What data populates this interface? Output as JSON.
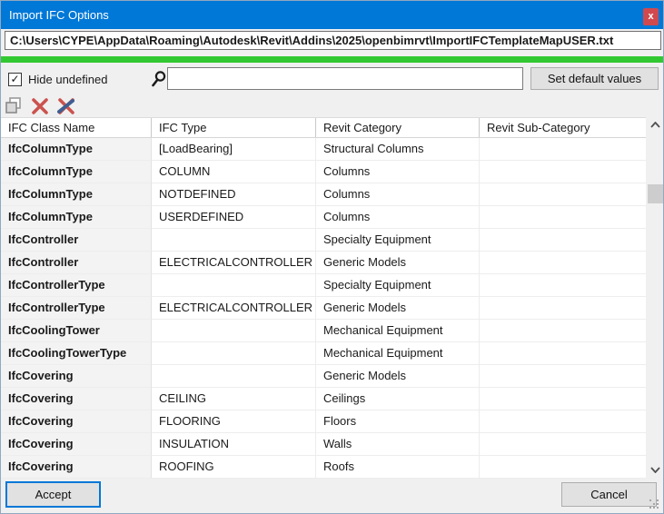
{
  "window": {
    "title": "Import IFC Options",
    "close_glyph": "x"
  },
  "path_bar": {
    "value": "C:\\Users\\CYPE\\AppData\\Roaming\\Autodesk\\Revit\\Addins\\2025\\openbimrvt\\ImportIFCTemplateMapUSER.txt"
  },
  "controls": {
    "hide_undefined_label": "Hide undefined",
    "hide_undefined_checked": true,
    "check_glyph": "✓",
    "search_value": "",
    "set_default_button_label": "Set default values"
  },
  "toolbar": {
    "icons": [
      "copy-icon",
      "delete-icon",
      "delete-all-icon"
    ]
  },
  "table": {
    "columns": [
      "IFC Class Name",
      "IFC Type",
      "Revit Category",
      "Revit Sub-Category"
    ],
    "rows": [
      [
        "IfcColumnType",
        "[LoadBearing]",
        "Structural Columns",
        ""
      ],
      [
        "IfcColumnType",
        "COLUMN",
        "Columns",
        ""
      ],
      [
        "IfcColumnType",
        "NOTDEFINED",
        "Columns",
        ""
      ],
      [
        "IfcColumnType",
        "USERDEFINED",
        "Columns",
        ""
      ],
      [
        "IfcController",
        "",
        "Specialty Equipment",
        ""
      ],
      [
        "IfcController",
        "ELECTRICALCONTROLLER",
        "Generic Models",
        ""
      ],
      [
        "IfcControllerType",
        "",
        "Specialty Equipment",
        ""
      ],
      [
        "IfcControllerType",
        "ELECTRICALCONTROLLER",
        "Generic Models",
        ""
      ],
      [
        "IfcCoolingTower",
        "",
        "Mechanical Equipment",
        ""
      ],
      [
        "IfcCoolingTowerType",
        "",
        "Mechanical Equipment",
        ""
      ],
      [
        "IfcCovering",
        "",
        "Generic Models",
        ""
      ],
      [
        "IfcCovering",
        "CEILING",
        "Ceilings",
        ""
      ],
      [
        "IfcCovering",
        "FLOORING",
        "Floors",
        ""
      ],
      [
        "IfcCovering",
        "INSULATION",
        "Walls",
        ""
      ],
      [
        "IfcCovering",
        "ROOFING",
        "Roofs",
        ""
      ]
    ]
  },
  "footer": {
    "accept_label": "Accept",
    "cancel_label": "Cancel"
  },
  "colors": {
    "titlebar": "#0078d7",
    "accent": "#0078d7",
    "green_bar": "#32c832",
    "close_button": "#d0494f",
    "delete_icon_red": "#cb524e",
    "pen_icon_blue": "#3f5e91"
  }
}
